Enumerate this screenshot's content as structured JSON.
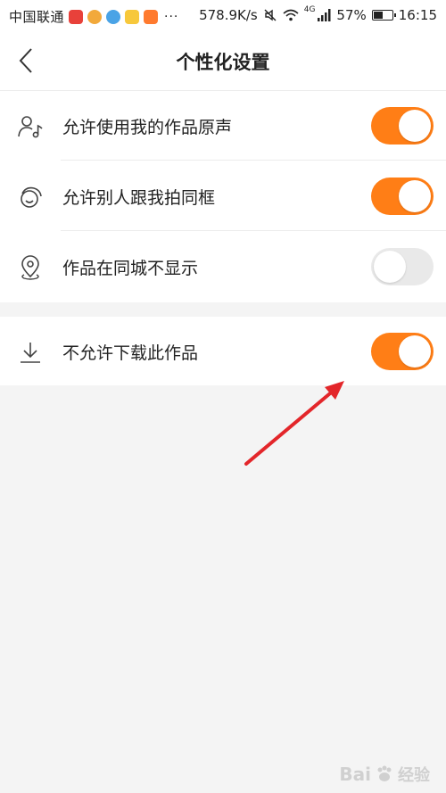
{
  "status_bar": {
    "carrier": "中国联通",
    "network_speed": "578.9K/s",
    "network_type": "4G",
    "battery": "57%",
    "time": "16:15",
    "more": "···",
    "app_icon_colors": [
      "#e8413a",
      "#f2a93b",
      "#4aa3e6",
      "#f7c83b",
      "#ff7a2e"
    ]
  },
  "nav": {
    "title": "个性化设置",
    "back_icon": "chevron-left-icon"
  },
  "settings": {
    "group1": [
      {
        "label": "允许使用我的作品原声",
        "icon": "person-music-icon",
        "enabled": true
      },
      {
        "label": "允许别人跟我拍同框",
        "icon": "duet-icon",
        "enabled": true
      },
      {
        "label": "作品在同城不显示",
        "icon": "location-icon",
        "enabled": false
      }
    ],
    "group2": [
      {
        "label": "不允许下载此作品",
        "icon": "download-icon",
        "enabled": true
      }
    ]
  },
  "colors": {
    "accent": "#ff7e16",
    "toggle_off": "#e9e9e9",
    "annotation_arrow": "#e3262a"
  },
  "watermark": {
    "brand": "Bai",
    "suffix": "经验"
  }
}
